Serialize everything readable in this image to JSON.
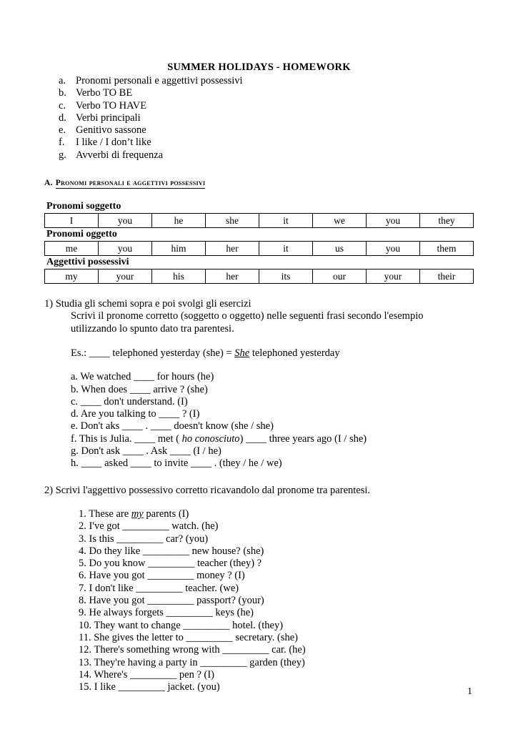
{
  "document": {
    "title": "SUMMER HOLIDAYS - HOMEWORK",
    "page_number": "1"
  },
  "topics": [
    {
      "marker": "a.",
      "label": "Pronomi personali e aggettivi possessivi"
    },
    {
      "marker": "b.",
      "label": "Verbo TO BE"
    },
    {
      "marker": "c.",
      "label": "Verbo TO HAVE"
    },
    {
      "marker": "d.",
      "label": "Verbi principali"
    },
    {
      "marker": "e.",
      "label": "Genitivo sassone"
    },
    {
      "marker": "f.",
      "label": "I like / I don’t like"
    },
    {
      "marker": "g.",
      "label": "Avverbi di frequenza"
    }
  ],
  "section": {
    "letter": "A.",
    "heading": "Pronomi personali e aggettivi possessivi"
  },
  "tables": [
    {
      "label": "Pronomi soggetto",
      "cells": [
        "I",
        "you",
        "he",
        "she",
        "it",
        "we",
        "you",
        "they"
      ]
    },
    {
      "label": "Pronomi oggetto",
      "cells": [
        "me",
        "you",
        "him",
        "her",
        "it",
        "us",
        "you",
        "them"
      ]
    },
    {
      "label": "Aggettivi possessivi",
      "cells": [
        "my",
        "your",
        "his",
        "her",
        "its",
        "our",
        "your",
        "their"
      ]
    }
  ],
  "exercise1": {
    "title": "1) Studia gli schemi sopra e poi svolgi gli esercizi",
    "instruction_line1": "Scrivi il pronome corretto (soggetto o oggetto) nelle seguenti frasi secondo l'esempio",
    "instruction_line2": "utilizzando lo spunto dato tra parentesi.",
    "example": {
      "lead": "Es.: ____ telephoned yesterday (she) = ",
      "answer": "She",
      "tail": " telephoned yesterday"
    },
    "items": [
      "a. We watched ____ for hours (he)",
      "b. When does ____ arrive ? (she)",
      "c. ____ don't understand. (I)",
      "d. Are you talking to ____ ? (I)",
      "e. Don't aks ____ . ____ doesn't know (she / she)"
    ],
    "item_f": {
      "part1": "f. This is Julia. ____ met ( ",
      "italic": "ho conosciuto",
      "part2": ") ____ three years ago (I / she)"
    },
    "items_tail": [
      "g. Don't ask ____ . Ask ____ (I / he)",
      "h. ____ asked ____ to invite ____ . (they / he / we)"
    ]
  },
  "exercise2": {
    "title": "2) Scrivi l'aggettivo possessivo corretto ricavandolo dal pronome tra parentesi.",
    "item_1": {
      "lead": "1. These are ",
      "answer": "my",
      "tail": " parents (I)"
    },
    "items": [
      "2. I've got _________ watch. (he)",
      "3. Is this _________ car? (you)",
      "4. Do they like _________ new house? (she)",
      "5. Do you know _________ teacher (they) ?",
      "6. Have you got _________ money ? (I)",
      "7. I don't like _________ teacher. (we)",
      "8. Have you got _________ passport? (your)",
      "9. He always forgets _________ keys (he)",
      "10. They want to change _________ hotel. (they)",
      "11. She gives the letter to _________ secretary. (she)",
      "12. There's something wrong with _________ car. (he)",
      "13. They're having a party in _________ garden (they)",
      "14. Where's _________ pen ? (I)",
      "15. I like _________ jacket. (you)"
    ]
  }
}
